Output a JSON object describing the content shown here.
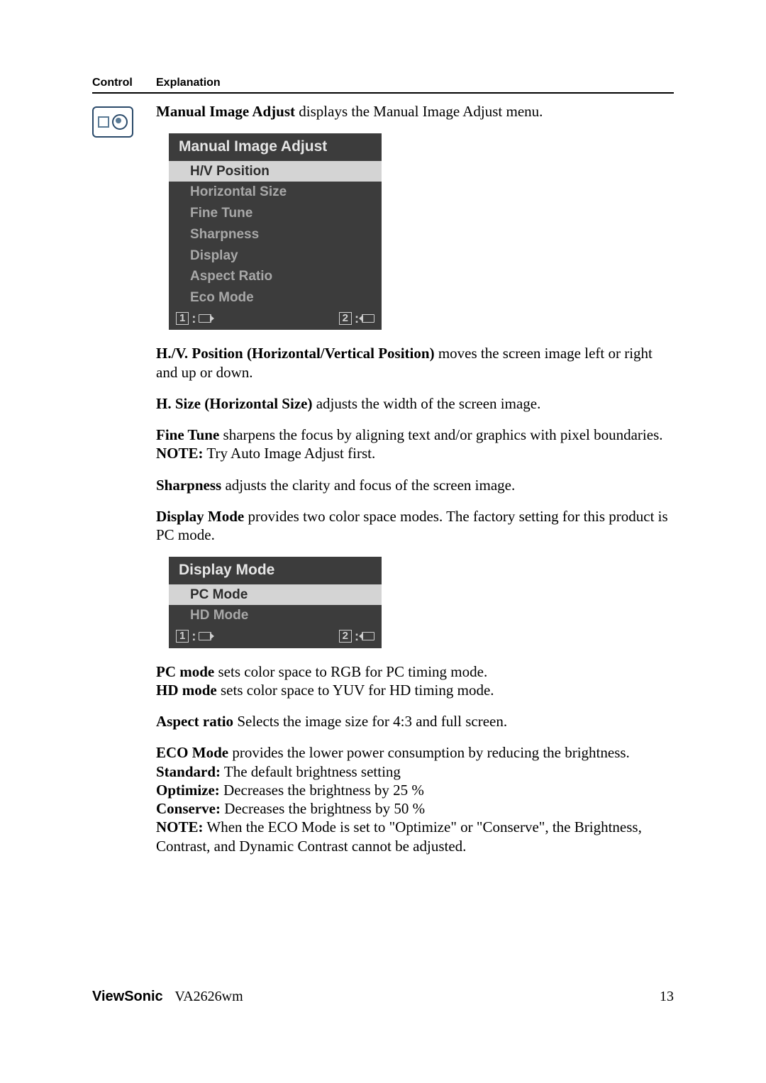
{
  "headers": {
    "control": "Control",
    "explanation": "Explanation"
  },
  "intro": {
    "b": "Manual Image Adjust",
    "rest": " displays the Manual Image Adjust menu."
  },
  "osd1": {
    "title": "Manual Image Adjust",
    "items": [
      "H/V Position",
      "Horizontal Size",
      "Fine Tune",
      "Sharpness",
      "Display",
      "Aspect Ratio",
      "Eco Mode"
    ],
    "footer": {
      "left": "1",
      "right": "2"
    }
  },
  "p_hv": {
    "b": "H./V. Position (Horizontal/Vertical Position)",
    "rest": " moves the screen image left or right and up or down."
  },
  "p_hsize": {
    "b": "H. Size (Horizontal Size)",
    "rest": " adjusts the width of the screen image."
  },
  "p_finetune": {
    "b": "Fine Tune",
    "rest": " sharpens the focus by aligning text and/or graphics with pixel boundaries."
  },
  "p_finetune_note": {
    "b": "NOTE:",
    "rest": " Try Auto Image Adjust first."
  },
  "p_sharp": {
    "b": "Sharpness",
    "rest": " adjusts the clarity and focus of the screen image."
  },
  "p_display": {
    "b": "Display Mode",
    "rest": " provides two color space modes. The factory setting for this product is PC mode."
  },
  "osd2": {
    "title": "Display Mode",
    "items": [
      "PC Mode",
      "HD Mode"
    ],
    "footer": {
      "left": "1",
      "right": "2"
    }
  },
  "p_pc": {
    "b": "PC mode",
    "rest": " sets color space to RGB for PC timing mode."
  },
  "p_hd": {
    "b": "HD mode",
    "rest": " sets color space to YUV for HD timing mode."
  },
  "p_aspect": {
    "b": "Aspect ratio",
    "rest": " Selects the image size for 4:3 and full screen."
  },
  "p_eco": {
    "b": "ECO Mode",
    "rest": " provides the lower power consumption by reducing the brightness."
  },
  "p_std": {
    "b": "Standard:",
    "rest": " The default brightness setting"
  },
  "p_opt": {
    "b": "Optimize:",
    "rest": " Decreases the brightness by 25 %"
  },
  "p_con": {
    "b": "Conserve:",
    "rest": " Decreases the brightness by 50 %"
  },
  "p_eco_note": {
    "b": "NOTE:",
    "rest": " When the ECO Mode is set to \"Optimize\" or \"Conserve\", the Brightness, Contrast, and Dynamic Contrast cannot be adjusted."
  },
  "footer": {
    "brand": "ViewSonic",
    "model": "VA2626wm",
    "page": "13"
  }
}
